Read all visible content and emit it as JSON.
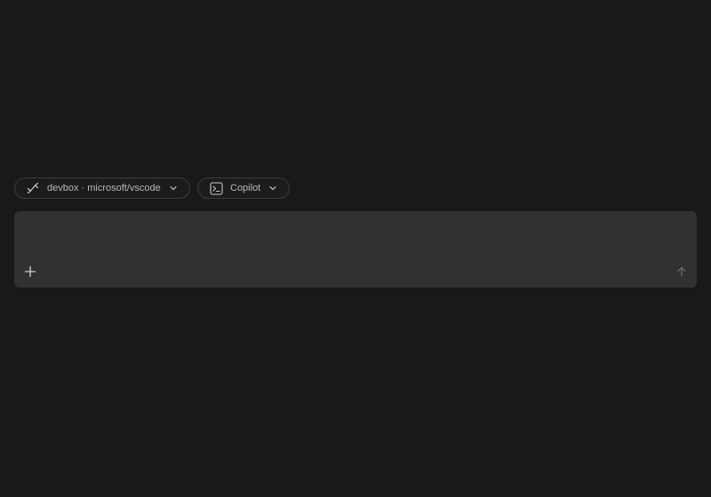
{
  "toolbar": {
    "remote": {
      "icon": "remote-connection-icon",
      "label": "devbox · microsoft/vscode"
    },
    "agent": {
      "icon": "terminal-icon",
      "label": "Copilot"
    }
  },
  "composer": {
    "value": "",
    "placeholder": "",
    "add_icon": "plus-icon",
    "send_icon": "arrow-up-icon"
  },
  "colors": {
    "background": "#191919",
    "composer_background": "#313131",
    "pill_border": "#3d3d3d",
    "text": "#b8b8b8"
  }
}
